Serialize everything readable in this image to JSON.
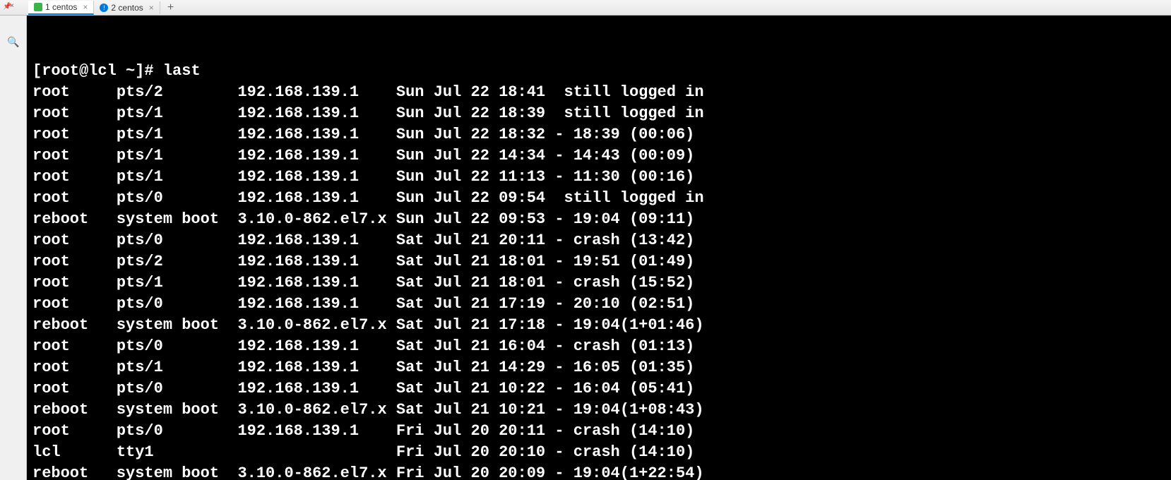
{
  "tabs": [
    {
      "label": "1 centos",
      "active": true
    },
    {
      "label": "2 centos",
      "active": false
    }
  ],
  "prompt": "[root@lcl ~]# ",
  "command": "last",
  "entries": [
    {
      "user": "root",
      "tty": "pts/2",
      "from": "192.168.139.1",
      "login": "Sun Jul 22 18:41",
      "sep": "  ",
      "end": "still logged in",
      "dur": ""
    },
    {
      "user": "root",
      "tty": "pts/1",
      "from": "192.168.139.1",
      "login": "Sun Jul 22 18:39",
      "sep": "  ",
      "end": "still logged in",
      "dur": ""
    },
    {
      "user": "root",
      "tty": "pts/1",
      "from": "192.168.139.1",
      "login": "Sun Jul 22 18:32",
      "sep": " - ",
      "end": "18:39",
      "dur": " (00:06)"
    },
    {
      "user": "root",
      "tty": "pts/1",
      "from": "192.168.139.1",
      "login": "Sun Jul 22 14:34",
      "sep": " - ",
      "end": "14:43",
      "dur": " (00:09)"
    },
    {
      "user": "root",
      "tty": "pts/1",
      "from": "192.168.139.1",
      "login": "Sun Jul 22 11:13",
      "sep": " - ",
      "end": "11:30",
      "dur": " (00:16)"
    },
    {
      "user": "root",
      "tty": "pts/0",
      "from": "192.168.139.1",
      "login": "Sun Jul 22 09:54",
      "sep": "  ",
      "end": "still logged in",
      "dur": ""
    },
    {
      "user": "reboot",
      "tty": "system boot",
      "from": "3.10.0-862.el7.x",
      "login": "Sun Jul 22 09:53",
      "sep": " - ",
      "end": "19:04",
      "dur": " (09:11)"
    },
    {
      "user": "root",
      "tty": "pts/0",
      "from": "192.168.139.1",
      "login": "Sat Jul 21 20:11",
      "sep": " - ",
      "end": "crash",
      "dur": " (13:42)"
    },
    {
      "user": "root",
      "tty": "pts/2",
      "from": "192.168.139.1",
      "login": "Sat Jul 21 18:01",
      "sep": " - ",
      "end": "19:51",
      "dur": " (01:49)"
    },
    {
      "user": "root",
      "tty": "pts/1",
      "from": "192.168.139.1",
      "login": "Sat Jul 21 18:01",
      "sep": " - ",
      "end": "crash",
      "dur": " (15:52)"
    },
    {
      "user": "root",
      "tty": "pts/0",
      "from": "192.168.139.1",
      "login": "Sat Jul 21 17:19",
      "sep": " - ",
      "end": "20:10",
      "dur": " (02:51)"
    },
    {
      "user": "reboot",
      "tty": "system boot",
      "from": "3.10.0-862.el7.x",
      "login": "Sat Jul 21 17:18",
      "sep": " - ",
      "end": "19:04",
      "dur": "(1+01:46)"
    },
    {
      "user": "root",
      "tty": "pts/0",
      "from": "192.168.139.1",
      "login": "Sat Jul 21 16:04",
      "sep": " - ",
      "end": "crash",
      "dur": " (01:13)"
    },
    {
      "user": "root",
      "tty": "pts/1",
      "from": "192.168.139.1",
      "login": "Sat Jul 21 14:29",
      "sep": " - ",
      "end": "16:05",
      "dur": " (01:35)"
    },
    {
      "user": "root",
      "tty": "pts/0",
      "from": "192.168.139.1",
      "login": "Sat Jul 21 10:22",
      "sep": " - ",
      "end": "16:04",
      "dur": " (05:41)"
    },
    {
      "user": "reboot",
      "tty": "system boot",
      "from": "3.10.0-862.el7.x",
      "login": "Sat Jul 21 10:21",
      "sep": " - ",
      "end": "19:04",
      "dur": "(1+08:43)"
    },
    {
      "user": "root",
      "tty": "pts/0",
      "from": "192.168.139.1",
      "login": "Fri Jul 20 20:11",
      "sep": " - ",
      "end": "crash",
      "dur": " (14:10)"
    },
    {
      "user": "lcl",
      "tty": "tty1",
      "from": "",
      "login": "Fri Jul 20 20:10",
      "sep": " - ",
      "end": "crash",
      "dur": " (14:10)"
    },
    {
      "user": "reboot",
      "tty": "system boot",
      "from": "3.10.0-862.el7.x",
      "login": "Fri Jul 20 20:09",
      "sep": " - ",
      "end": "19:04",
      "dur": "(1+22:54)"
    }
  ]
}
